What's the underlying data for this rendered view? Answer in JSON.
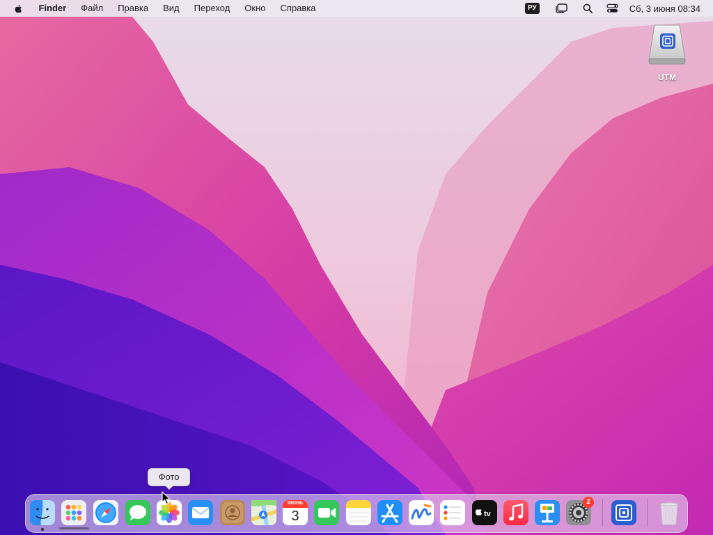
{
  "menubar": {
    "app_name": "Finder",
    "items": [
      "Файл",
      "Правка",
      "Вид",
      "Переход",
      "Окно",
      "Справка"
    ],
    "input_source": "РУ",
    "clock": "Сб, 3 июня  08:34"
  },
  "desktop": {
    "items": [
      {
        "label": "UTM",
        "icon": "utm-disk-icon"
      }
    ]
  },
  "tooltip": {
    "text": "Фото"
  },
  "dock": {
    "apps": [
      {
        "name": "Finder",
        "icon": "finder-icon",
        "running": true
      },
      {
        "name": "Launchpad",
        "icon": "launchpad-icon"
      },
      {
        "name": "Safari",
        "icon": "safari-icon"
      },
      {
        "name": "Messages",
        "icon": "messages-icon"
      },
      {
        "name": "Photos",
        "icon": "photos-icon"
      },
      {
        "name": "Mail",
        "icon": "mail-icon"
      },
      {
        "name": "Contacts",
        "icon": "contacts-icon"
      },
      {
        "name": "Maps",
        "icon": "maps-icon"
      },
      {
        "name": "Calendar",
        "icon": "calendar-icon"
      },
      {
        "name": "FaceTime",
        "icon": "facetime-icon"
      },
      {
        "name": "Notes",
        "icon": "notes-icon"
      },
      {
        "name": "App Store",
        "icon": "app-store-icon"
      },
      {
        "name": "Freeform",
        "icon": "freeform-icon"
      },
      {
        "name": "Reminders",
        "icon": "reminders-icon"
      },
      {
        "name": "TV",
        "icon": "tv-icon"
      },
      {
        "name": "Music",
        "icon": "music-icon"
      },
      {
        "name": "Keynote",
        "icon": "keynote-icon"
      },
      {
        "name": "System Settings",
        "icon": "system-settings-icon"
      },
      {
        "name": "UTM",
        "icon": "utm-icon"
      },
      {
        "name": "Trash",
        "icon": "trash-icon"
      }
    ],
    "calendar": {
      "month": "ИЮНЬ",
      "day": "3"
    },
    "tv_label": "tv",
    "settings_badge": "2"
  },
  "colors": {
    "menubar_bg": "#ece6ee",
    "accent_badge": "#ff3b30"
  }
}
